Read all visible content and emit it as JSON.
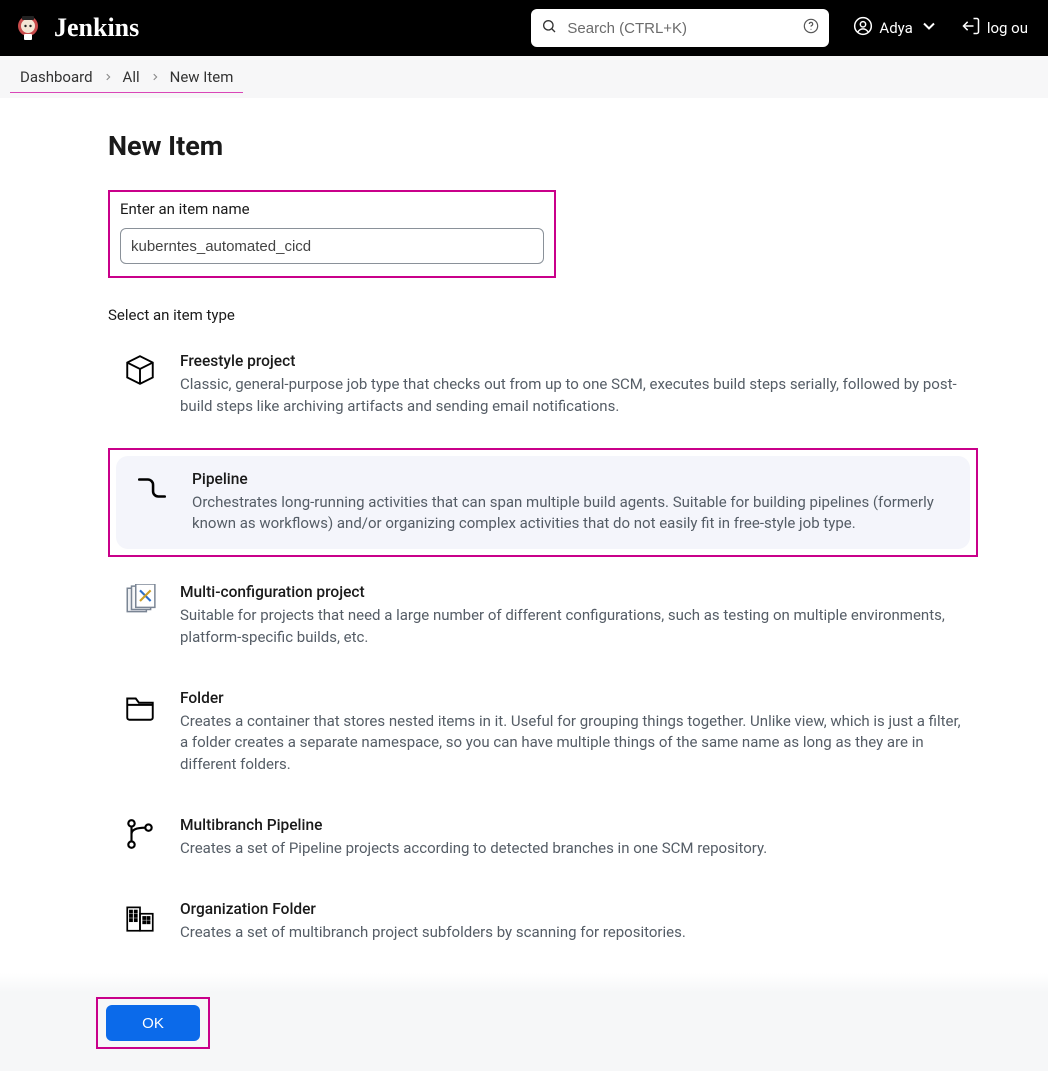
{
  "header": {
    "brand": "Jenkins",
    "search_placeholder": "Search (CTRL+K)",
    "user_name": "Adya",
    "logout_label": "log ou"
  },
  "breadcrumb": {
    "items": [
      {
        "label": "Dashboard"
      },
      {
        "label": "All"
      },
      {
        "label": "New Item"
      }
    ]
  },
  "page": {
    "title": "New Item",
    "name_label": "Enter an item name",
    "name_value": "kuberntes_automated_cicd",
    "section_label": "Select an item type"
  },
  "item_types": [
    {
      "id": "freestyle",
      "title": "Freestyle project",
      "desc": "Classic, general-purpose job type that checks out from up to one SCM, executes build steps serially, followed by post-build steps like archiving artifacts and sending email notifications."
    },
    {
      "id": "pipeline",
      "title": "Pipeline",
      "desc": "Orchestrates long-running activities that can span multiple build agents. Suitable for building pipelines (formerly known as workflows) and/or organizing complex activities that do not easily fit in free-style job type.",
      "selected": true
    },
    {
      "id": "multi-config",
      "title": "Multi-configuration project",
      "desc": "Suitable for projects that need a large number of different configurations, such as testing on multiple environments, platform-specific builds, etc."
    },
    {
      "id": "folder",
      "title": "Folder",
      "desc": "Creates a container that stores nested items in it. Useful for grouping things together. Unlike view, which is just a filter, a folder creates a separate namespace, so you can have multiple things of the same name as long as they are in different folders."
    },
    {
      "id": "multibranch",
      "title": "Multibranch Pipeline",
      "desc": "Creates a set of Pipeline projects according to detected branches in one SCM repository."
    },
    {
      "id": "org-folder",
      "title": "Organization Folder",
      "desc": "Creates a set of multibranch project subfolders by scanning for repositories."
    }
  ],
  "footer": {
    "ok_label": "OK"
  }
}
